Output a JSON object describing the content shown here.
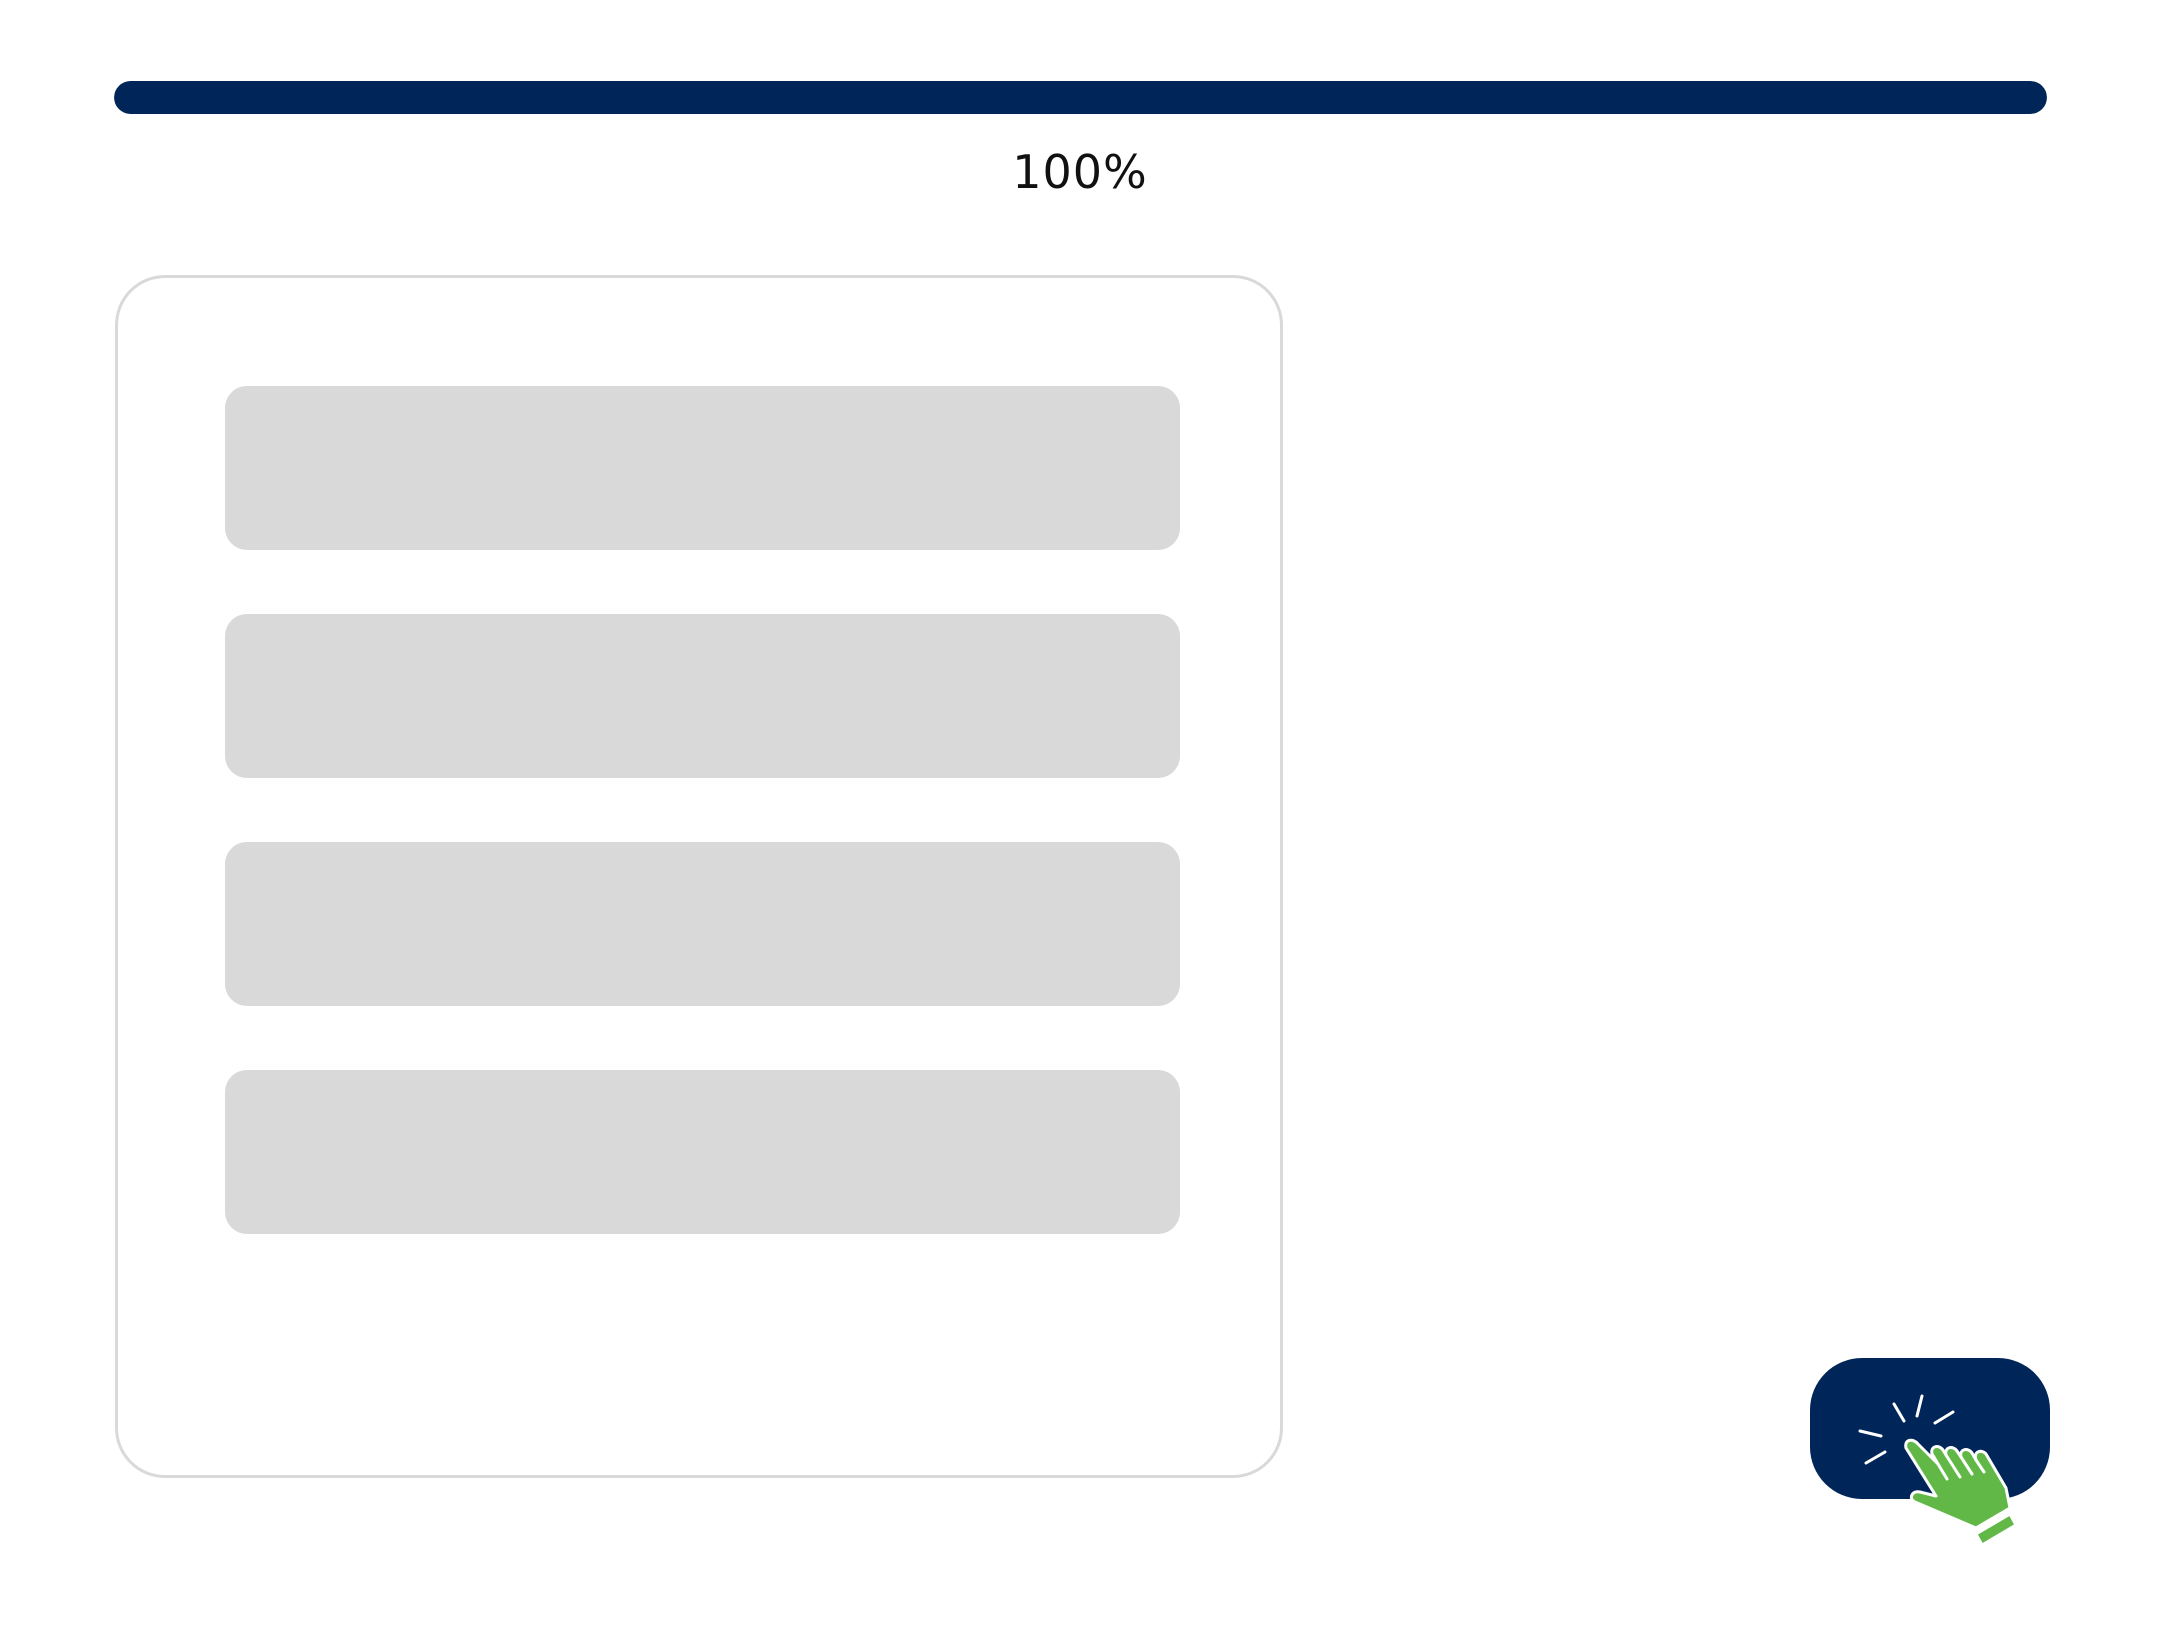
{
  "progress": {
    "value_percent": 100,
    "label": "100%",
    "fill_color": "#002659"
  },
  "options": [
    {
      "label": ""
    },
    {
      "label": ""
    },
    {
      "label": ""
    },
    {
      "label": ""
    }
  ],
  "submit": {
    "icon": "tap-hand-icon",
    "background_color": "#002659",
    "icon_color": "#62b847"
  }
}
